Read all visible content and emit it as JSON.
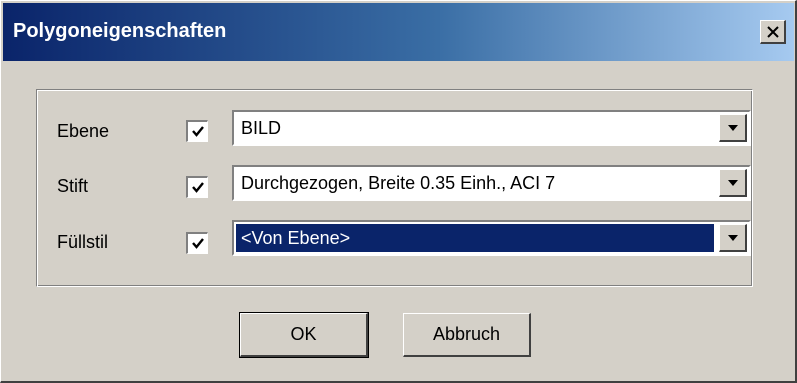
{
  "dialog": {
    "title": "Polygoneigenschaften",
    "close_icon": "close-icon"
  },
  "rows": [
    {
      "label": "Ebene",
      "checked": true,
      "value": "BILD",
      "selected": false
    },
    {
      "label": "Stift",
      "checked": true,
      "value": "Durchgezogen, Breite 0.35 Einh., ACI 7",
      "selected": false
    },
    {
      "label": "Füllstil",
      "checked": true,
      "value": "<Von Ebene>",
      "selected": true
    }
  ],
  "buttons": {
    "ok": "OK",
    "cancel": "Abbruch"
  },
  "colors": {
    "title_bar_start": "#0a246a",
    "title_bar_end": "#a6caf0",
    "selection": "#0a246a",
    "face": "#d4d0c8"
  }
}
